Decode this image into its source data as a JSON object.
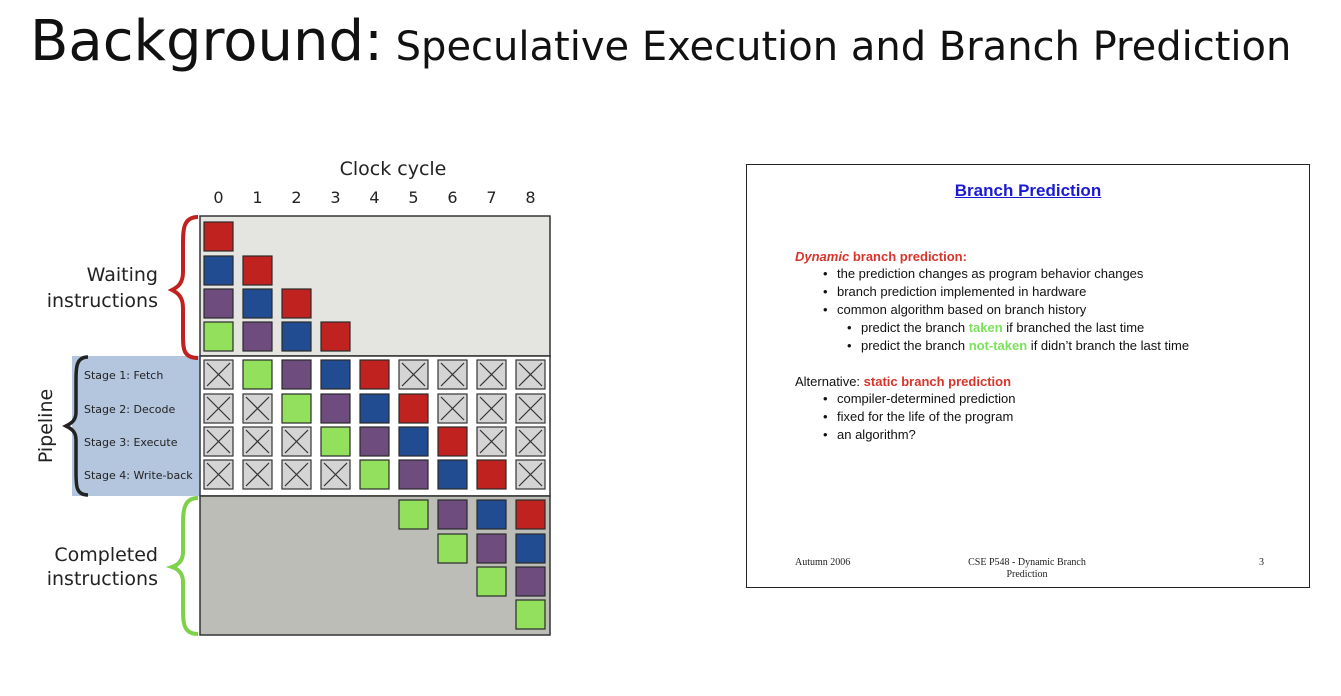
{
  "title": {
    "main": "Background:",
    "sub": " Speculative Execution and Branch Prediction"
  },
  "colors": {
    "red": "#c0221f",
    "blue": "#214c91",
    "purple": "#6e4c7d",
    "green": "#93e05d",
    "pipeline_bg": "#b4c5de",
    "upper_bg": "#e4e4e0",
    "lower_bg": "#bdbdb8",
    "bracket_red": "#c0221f",
    "bracket_green": "#7fd14a",
    "bracket_dark": "#222222",
    "empty_cell": "#d4d4d4"
  },
  "diagram": {
    "axis_label": "Clock cycle",
    "cycles": [
      "0",
      "1",
      "2",
      "3",
      "4",
      "5",
      "6",
      "7",
      "8"
    ],
    "waiting_label": [
      "Waiting",
      "instructions"
    ],
    "completed_label": [
      "Completed",
      "instructions"
    ],
    "pipeline_label": "Pipeline",
    "stages": [
      "Stage 1: Fetch",
      "Stage 2: Decode",
      "Stage 3: Execute",
      "Stage 4: Write-back"
    ],
    "waiting_grid": [
      [
        "red",
        null,
        null,
        null
      ],
      [
        "blue",
        "red",
        null,
        null
      ],
      [
        "purple",
        "blue",
        "red",
        null
      ],
      [
        "green",
        "purple",
        "blue",
        "red"
      ]
    ],
    "pipeline_grid": [
      [
        "x",
        "green",
        "purple",
        "blue",
        "red",
        "x",
        "x",
        "x",
        "x"
      ],
      [
        "x",
        "x",
        "green",
        "purple",
        "blue",
        "red",
        "x",
        "x",
        "x"
      ],
      [
        "x",
        "x",
        "x",
        "green",
        "purple",
        "blue",
        "red",
        "x",
        "x"
      ],
      [
        "x",
        "x",
        "x",
        "x",
        "green",
        "purple",
        "blue",
        "red",
        "x"
      ]
    ],
    "completed_grid": [
      [
        null,
        null,
        null,
        null,
        null,
        "green",
        "purple",
        "blue",
        "red"
      ],
      [
        null,
        null,
        null,
        null,
        null,
        null,
        "green",
        "purple",
        "blue"
      ],
      [
        null,
        null,
        null,
        null,
        null,
        null,
        null,
        "green",
        "purple"
      ],
      [
        null,
        null,
        null,
        null,
        null,
        null,
        null,
        null,
        "green"
      ]
    ]
  },
  "slide": {
    "title": "Branch Prediction",
    "dynamic": {
      "head_italic": "Dynamic",
      "head_rest": " branch prediction:",
      "bullets": [
        "the prediction changes as program behavior changes",
        "branch prediction implemented in hardware",
        "common algorithm based on branch history"
      ],
      "sub1_pre": "predict the branch ",
      "sub1_hl": "taken",
      "sub1_post": " if branched the last time",
      "sub2_pre": "predict the branch ",
      "sub2_hl": "not-taken",
      "sub2_post": " if didn’t branch the last time"
    },
    "alternative": {
      "head_plain": "Alternative: ",
      "head_red": "static branch prediction",
      "bullets": [
        "compiler-determined prediction",
        "fixed for the life of the program",
        "an algorithm?"
      ]
    },
    "footer": {
      "left": "Autumn 2006",
      "center_line1": "CSE P548 - Dynamic Branch",
      "center_line2": "Prediction",
      "page": "3"
    }
  }
}
